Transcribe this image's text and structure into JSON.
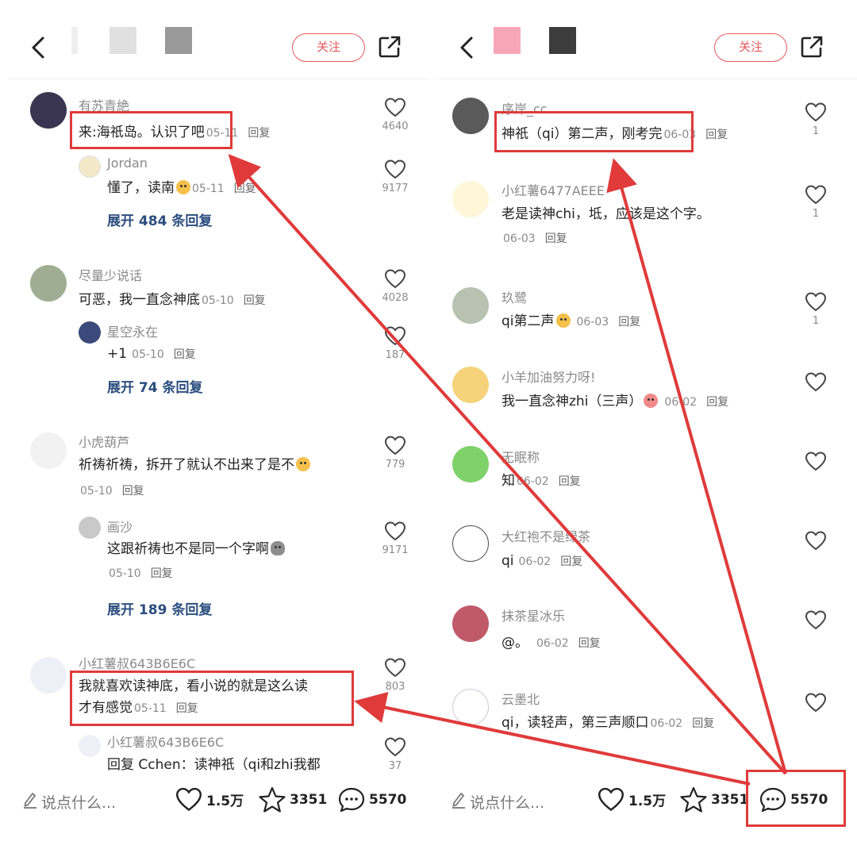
{
  "left": {
    "follow_label": "关注",
    "comments": [
      {
        "user": "有苏青絶",
        "text": "来:海祇岛。认识了吧",
        "date": "05-11",
        "reply": "回复",
        "likes": "4640"
      },
      {
        "user": "Jordan",
        "text": "懂了，读南",
        "date": "05-11",
        "reply": "回复",
        "likes": "9177"
      },
      {
        "expand": "展开 484 条回复"
      },
      {
        "user": "尽量少说话",
        "text": "可恶，我一直念神底",
        "date": "05-10",
        "reply": "回复",
        "likes": "4028"
      },
      {
        "user": "星空永在",
        "text": "+1",
        "date": "05-10",
        "reply": "回复",
        "likes": "187"
      },
      {
        "expand": "展开 74 条回复"
      },
      {
        "user": "小虎葫芦",
        "text": "祈祷祈祷，拆开了就认不出来了是不",
        "date": "05-10",
        "reply": "回复",
        "likes": "779"
      },
      {
        "user": "画沙",
        "text": "这跟祈祷也不是同一个字啊",
        "date": "05-10",
        "reply": "回复",
        "likes": "9171"
      },
      {
        "expand": "展开 189 条回复"
      },
      {
        "user": "小红薯叔643B6E6C",
        "text_line1": "我就喜欢读神底，看小说的就是这么读",
        "text_line2": "才有感觉",
        "date": "05-11",
        "reply": "回复",
        "likes": "803"
      },
      {
        "user": "小红薯叔643B6E6C",
        "text": "回复 Cchen：读神祇（qi和zhi我都",
        "likes": "37"
      }
    ],
    "bottom": {
      "placeholder": "说点什么...",
      "likes": "1.5万",
      "stars": "3351",
      "comments": "5570"
    }
  },
  "right": {
    "follow_label": "关注",
    "comments": [
      {
        "user": "序岸_cc",
        "text": "神祇（qi）第二声，刚考完",
        "date": "06-03",
        "reply": "回复",
        "likes": "1"
      },
      {
        "user": "小红薯6477AEEE",
        "text": "老是读神chi，坻，应该是这个字。",
        "date": "06-03",
        "reply": "回复",
        "likes": "1"
      },
      {
        "user": "玖鹭",
        "text": "qi第二声",
        "date": "06-03",
        "reply": "回复",
        "likes": "1"
      },
      {
        "user": "小羊加油努力呀!",
        "text": "我一直念神zhi（三声）",
        "date": "06-02",
        "reply": "回复",
        "likes": ""
      },
      {
        "user": "无眠称",
        "text": "知",
        "date": "06-02",
        "reply": "回复",
        "likes": ""
      },
      {
        "user": "大红袍不是绿茶",
        "text": "qi",
        "date": "06-02",
        "reply": "回复",
        "likes": ""
      },
      {
        "user": "抹茶星冰乐",
        "text": "@。",
        "date": "06-02",
        "reply": "回复",
        "likes": ""
      },
      {
        "user": "云墨北",
        "text": "qi，读轻声，第三声顺口",
        "date": "06-02",
        "reply": "回复",
        "likes": ""
      }
    ],
    "bottom": {
      "placeholder": "说点什么...",
      "likes": "1.5万",
      "stars": "3351",
      "comments": "5570"
    }
  },
  "colors": {
    "accent_red": "#e03a3a",
    "follow_red": "#e4585b",
    "expand_blue": "#2b4d7e"
  },
  "icons": [
    "back-arrow-icon",
    "share-icon",
    "heart-icon",
    "star-icon",
    "chat-bubble-icon",
    "pen-icon"
  ]
}
